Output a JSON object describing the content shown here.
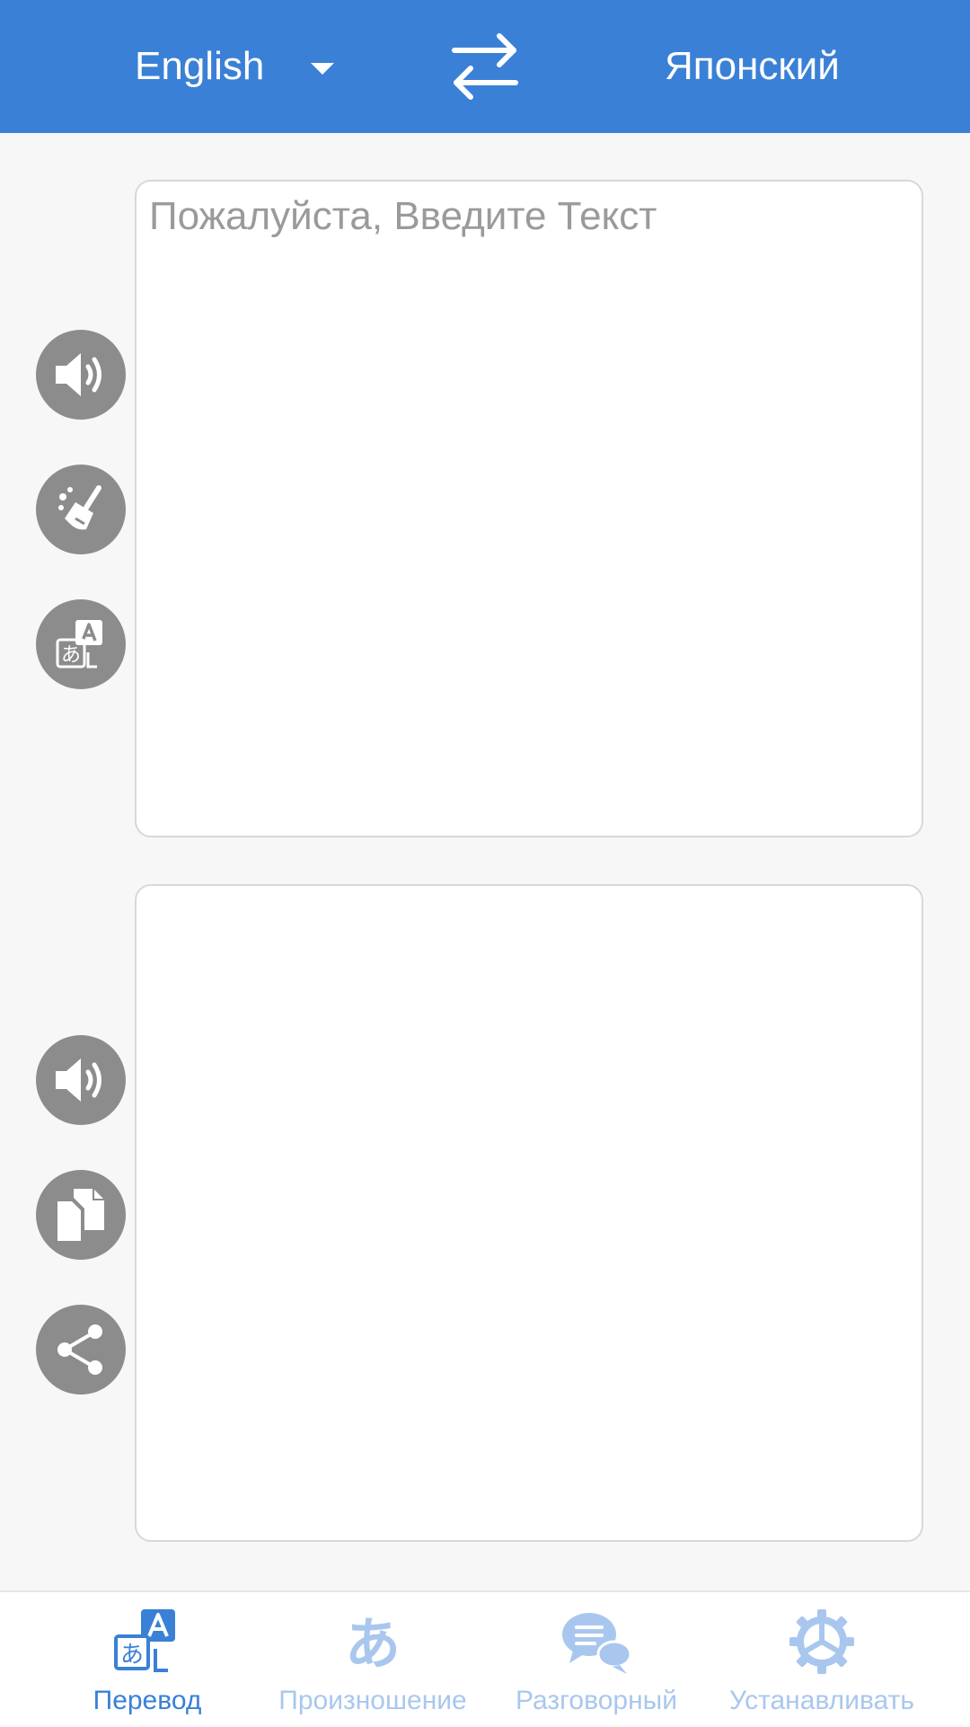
{
  "header": {
    "source_language": "English",
    "target_language": "Японский"
  },
  "source_panel": {
    "placeholder": "Пожалуйста, Введите Текст",
    "value": ""
  },
  "target_panel": {
    "value": ""
  },
  "source_actions": [
    "speaker-icon",
    "broom-icon",
    "translate-icon"
  ],
  "target_actions": [
    "speaker-icon",
    "copy-icon",
    "share-icon"
  ],
  "bottom_nav": {
    "items": [
      {
        "label": "Перевод",
        "icon": "translate-icon",
        "active": true
      },
      {
        "label": "Произношение",
        "icon": "hiragana-a-icon",
        "active": false
      },
      {
        "label": "Разговорный",
        "icon": "chat-bubbles-icon",
        "active": false
      },
      {
        "label": "Устанавливать",
        "icon": "gear-icon",
        "active": false
      }
    ]
  },
  "colors": {
    "brand": "#3a80d6",
    "button_gray": "#8c8c8c",
    "nav_inactive": "#a9c7ee",
    "background": "#f7f7f7"
  }
}
